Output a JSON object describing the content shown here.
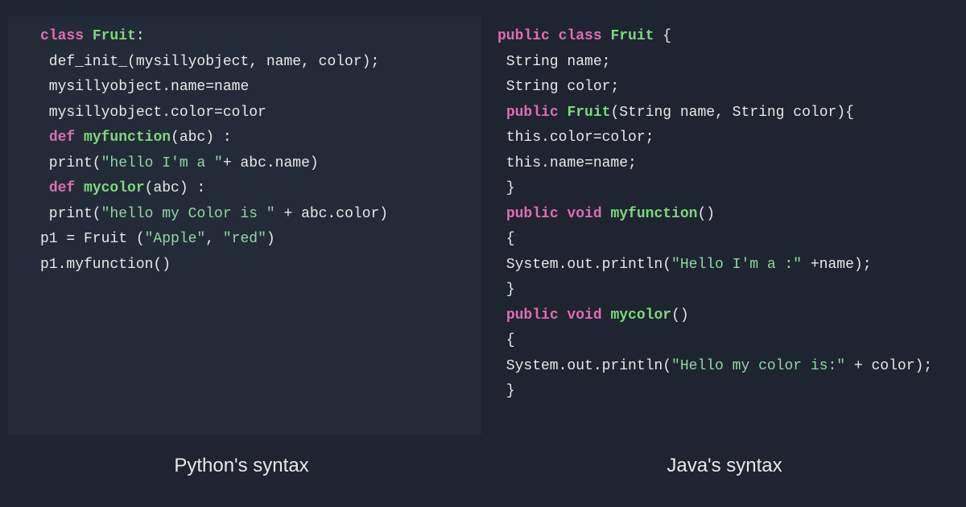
{
  "python": {
    "label": "Python's syntax",
    "lines": [
      [
        {
          "t": "class ",
          "c": "kw"
        },
        {
          "t": "Fruit",
          "c": "cls"
        },
        {
          "t": ":",
          "c": ""
        }
      ],
      [
        {
          "t": " def_init_(mysillyobject, name, color);",
          "c": ""
        }
      ],
      [
        {
          "t": " mysillyobject.name=name",
          "c": ""
        }
      ],
      [
        {
          "t": " mysillyobject.color=color",
          "c": ""
        }
      ],
      [
        {
          "t": " ",
          "c": ""
        },
        {
          "t": "def ",
          "c": "kw"
        },
        {
          "t": "myfunction",
          "c": "fn"
        },
        {
          "t": "(abc) :",
          "c": ""
        }
      ],
      [
        {
          "t": " print(",
          "c": ""
        },
        {
          "t": "\"hello I'm a \"",
          "c": "str"
        },
        {
          "t": "+ abc.name)",
          "c": ""
        }
      ],
      [
        {
          "t": " ",
          "c": ""
        },
        {
          "t": "def ",
          "c": "kw"
        },
        {
          "t": "mycolor",
          "c": "fn"
        },
        {
          "t": "(abc) :",
          "c": ""
        }
      ],
      [
        {
          "t": " print(",
          "c": ""
        },
        {
          "t": "\"hello my Color is \"",
          "c": "str"
        },
        {
          "t": " + abc.color)",
          "c": ""
        }
      ],
      [
        {
          "t": "p1 = Fruit (",
          "c": ""
        },
        {
          "t": "\"Apple\"",
          "c": "str"
        },
        {
          "t": ", ",
          "c": ""
        },
        {
          "t": "\"red\"",
          "c": "str"
        },
        {
          "t": ")",
          "c": ""
        }
      ],
      [
        {
          "t": "p1.myfunction()",
          "c": ""
        }
      ]
    ]
  },
  "java": {
    "label": "Java's syntax",
    "lines": [
      [
        {
          "t": "public class ",
          "c": "kw"
        },
        {
          "t": "Fruit",
          "c": "cls"
        },
        {
          "t": " {",
          "c": ""
        }
      ],
      [
        {
          "t": " String name;",
          "c": ""
        }
      ],
      [
        {
          "t": " String color;",
          "c": ""
        }
      ],
      [
        {
          "t": " ",
          "c": ""
        },
        {
          "t": "public ",
          "c": "kw"
        },
        {
          "t": "Fruit",
          "c": "fn"
        },
        {
          "t": "(String name, String color){",
          "c": ""
        }
      ],
      [
        {
          "t": " this",
          "c": ""
        },
        {
          "t": ".color=color;",
          "c": ""
        }
      ],
      [
        {
          "t": " this",
          "c": ""
        },
        {
          "t": ".name=name;",
          "c": ""
        }
      ],
      [
        {
          "t": " }",
          "c": ""
        }
      ],
      [
        {
          "t": " ",
          "c": ""
        },
        {
          "t": "public void ",
          "c": "kw"
        },
        {
          "t": "myfunction",
          "c": "fn"
        },
        {
          "t": "()",
          "c": ""
        }
      ],
      [
        {
          "t": " {",
          "c": ""
        }
      ],
      [
        {
          "t": " System.out.println(",
          "c": ""
        },
        {
          "t": "\"Hello I'm a :\"",
          "c": "str"
        },
        {
          "t": " +name);",
          "c": ""
        }
      ],
      [
        {
          "t": " }",
          "c": ""
        }
      ],
      [
        {
          "t": " ",
          "c": ""
        },
        {
          "t": "public void ",
          "c": "kw"
        },
        {
          "t": "mycolor",
          "c": "fn"
        },
        {
          "t": "()",
          "c": ""
        }
      ],
      [
        {
          "t": " {",
          "c": ""
        }
      ],
      [
        {
          "t": " System.out.println(",
          "c": ""
        },
        {
          "t": "\"Hello my color is:\"",
          "c": "str"
        },
        {
          "t": " + color);",
          "c": ""
        }
      ],
      [
        {
          "t": " }",
          "c": ""
        }
      ]
    ]
  }
}
